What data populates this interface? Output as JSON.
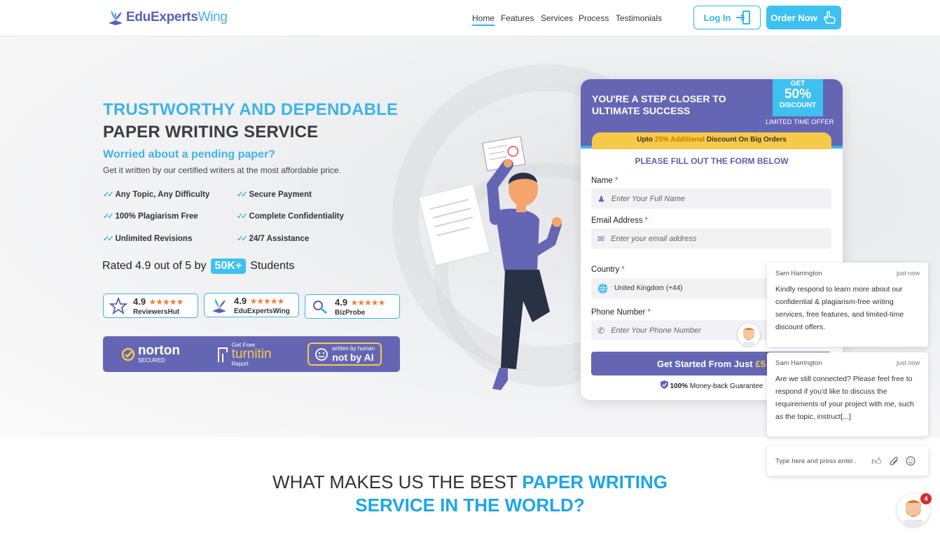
{
  "header": {
    "logo_part1": "EduExperts",
    "logo_part2": "Wing",
    "nav": [
      "Home",
      "Features",
      "Services",
      "Process",
      "Testimonials"
    ],
    "login_label": "Log In",
    "order_label": "Order Now"
  },
  "hero": {
    "title_line1": "TRUSTWORTHY AND DEPENDABLE",
    "title_line2": "PAPER WRITING SERVICE",
    "question": "Worried about a pending paper?",
    "subtitle": "Get it written by our certified writers at the most affordable price.",
    "features": [
      "Any Topic, Any Difficulty",
      "Secure Payment",
      "100% Plagiarism Free",
      "Complete Confidentiality",
      "Unlimited Revisions",
      "24/7 Assistance"
    ],
    "rated_prefix": "Rated 4.9 out of 5 by",
    "rated_badge": "50K+",
    "rated_suffix": "Students",
    "reviews": [
      {
        "score": "4.9",
        "site": "ReviewersHut"
      },
      {
        "score": "4.9",
        "site": "EduExpertsWing"
      },
      {
        "score": "4.9",
        "site": "BizProbe"
      }
    ],
    "trust": {
      "norton": "norton",
      "norton_sub": "SECURED",
      "turnitin_top": "Get Free",
      "turnitin": "turnitin",
      "turnitin_sub": "Report",
      "human_top": "written by human",
      "human": "not by AI"
    }
  },
  "form": {
    "head_line1": "YOU'RE A STEP CLOSER TO",
    "head_line2": "ULTIMATE SUCCESS",
    "disc_get": "GET",
    "disc_pct": "50%",
    "disc_word": "DISCOUNT",
    "limited": "LIMITED TIME OFFER",
    "upto_prefix": "Upto",
    "upto_pct": "25% Additional",
    "upto_suffix": "Discount On Big Orders",
    "fill_title": "PLEASE FILL OUT THE FORM BELOW",
    "name_label": "Name",
    "name_placeholder": "Enter Your Full Name",
    "email_label": "Email Address",
    "email_placeholder": "Enter your email address",
    "country_label": "Country",
    "country_value": "United Kingdom (+44)",
    "phone_label": "Phone Number",
    "phone_placeholder": "Enter Your Phone Number",
    "required_mark": "*",
    "submit_label": "Get Started From Just",
    "submit_price": "£5",
    "guarantee_bold": "100%",
    "guarantee_text": "Money-back Guarantee"
  },
  "chat": {
    "messages": [
      {
        "agent": "Sam Harrington",
        "time": "just now",
        "text": "Kindly respond to learn more about our confidential & plagiarism-free writing services, free features, and limited-time discount offers."
      },
      {
        "agent": "Sam Harrington",
        "time": "just now",
        "text": "Are we still connected? Please feel free to respond if you'd like to discuss the requirements of your project with me, such as the topic, instruct[...]"
      }
    ],
    "input_placeholder": "Type here and press enter..",
    "unread": "4"
  },
  "section": {
    "line1_plain": "WHAT MAKES US THE BEST",
    "line1_bold": "PAPER WRITING",
    "line2": "SERVICE IN THE WORLD?"
  },
  "colors": {
    "accent": "#3fb4e8",
    "brand": "#6466b4",
    "yellow": "#f7c948"
  }
}
